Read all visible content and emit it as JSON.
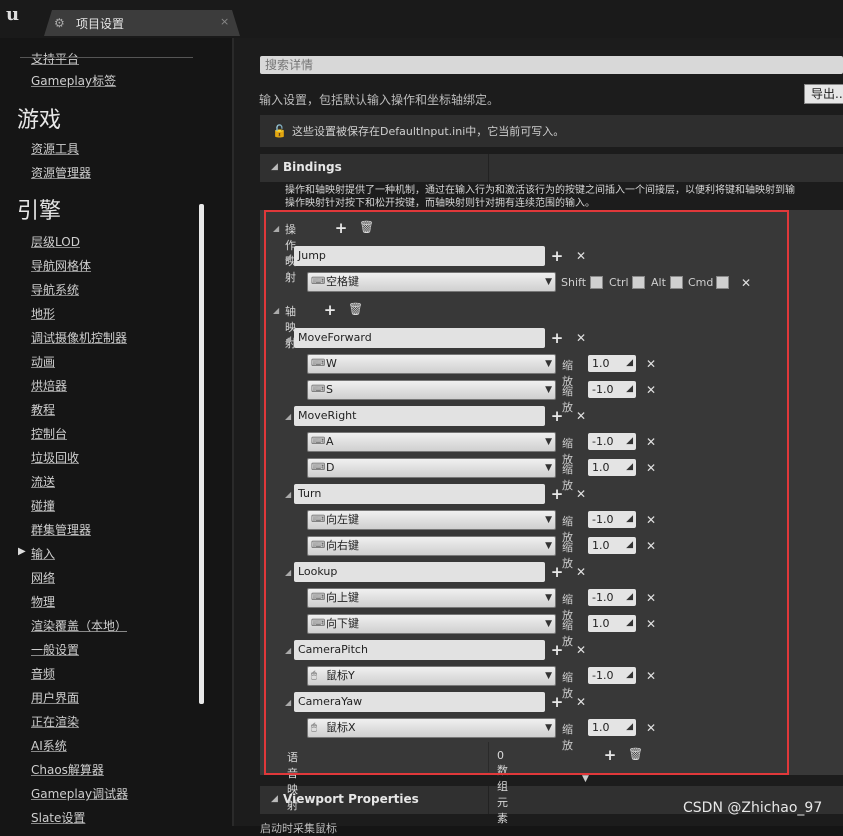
{
  "tab": {
    "title": "项目设置",
    "close": "×"
  },
  "sidebar": {
    "top_items": [
      "支持平台",
      "Gameplay标签"
    ],
    "game_header": "游戏",
    "game_items": [
      "资源工具",
      "资源管理器"
    ],
    "engine_header": "引擎",
    "engine_items": [
      "层级LOD",
      "导航网格体",
      "导航系统",
      "地形",
      "调试摄像机控制器",
      "动画",
      "烘焙器",
      "教程",
      "控制台",
      "垃圾回收",
      "流送",
      "碰撞",
      "群集管理器",
      "输入",
      "网络",
      "物理",
      "渲染覆盖（本地）",
      "一般设置",
      "音频",
      "用户界面",
      "正在渲染",
      "AI系统",
      "Chaos解算器",
      "Gameplay调试器",
      "Slate设置"
    ],
    "selected": "输入"
  },
  "search": {
    "placeholder": "搜索详情"
  },
  "description": "输入设置，包括默认输入操作和坐标轴绑定。",
  "export_label": "导出...",
  "notice": "这些设置被保存在DefaultInput.ini中，它当前可写入。",
  "bindings": {
    "title": "Bindings",
    "description_line1": "操作和轴映射提供了一种机制，通过在输入行为和激活该行为的按键之间插入一个间接层，以便利将键和轴映射到输",
    "description_line2": "操作映射针对按下和松开按键，而轴映射则针对拥有连续范围的输入。",
    "action_mappings_label": "操作映射",
    "axis_mappings_label": "轴映射",
    "speech_mappings_label": "语音映射",
    "speech_count": "0 数组元素",
    "actions": [
      {
        "name": "Jump",
        "key": "空格键",
        "mods": [
          "Shift",
          "Ctrl",
          "Alt",
          "Cmd"
        ]
      }
    ],
    "scale_label": "缩放",
    "axes": [
      {
        "name": "MoveForward",
        "keys": [
          {
            "key": "W",
            "scale": "1.0"
          },
          {
            "key": "S",
            "scale": "-1.0"
          }
        ]
      },
      {
        "name": "MoveRight",
        "keys": [
          {
            "key": "A",
            "scale": "-1.0"
          },
          {
            "key": "D",
            "scale": "1.0"
          }
        ]
      },
      {
        "name": "Turn",
        "keys": [
          {
            "key": "向左键",
            "scale": "-1.0"
          },
          {
            "key": "向右键",
            "scale": "1.0"
          }
        ]
      },
      {
        "name": "Lookup",
        "keys": [
          {
            "key": "向上键",
            "scale": "-1.0"
          },
          {
            "key": "向下键",
            "scale": "1.0"
          }
        ]
      },
      {
        "name": "CameraPitch",
        "keys": [
          {
            "key": "鼠标Y",
            "scale": "-1.0"
          }
        ]
      },
      {
        "name": "CameraYaw",
        "keys": [
          {
            "key": "鼠标X",
            "scale": "1.0"
          }
        ]
      }
    ]
  },
  "viewport": {
    "title": "Viewport Properties",
    "first_row": "启动时采集鼠标"
  },
  "watermark": "CSDN @Zhichao_97",
  "colors": {
    "highlight": "#e0383a",
    "panel": "#383838",
    "background": "#1c1c1c"
  }
}
